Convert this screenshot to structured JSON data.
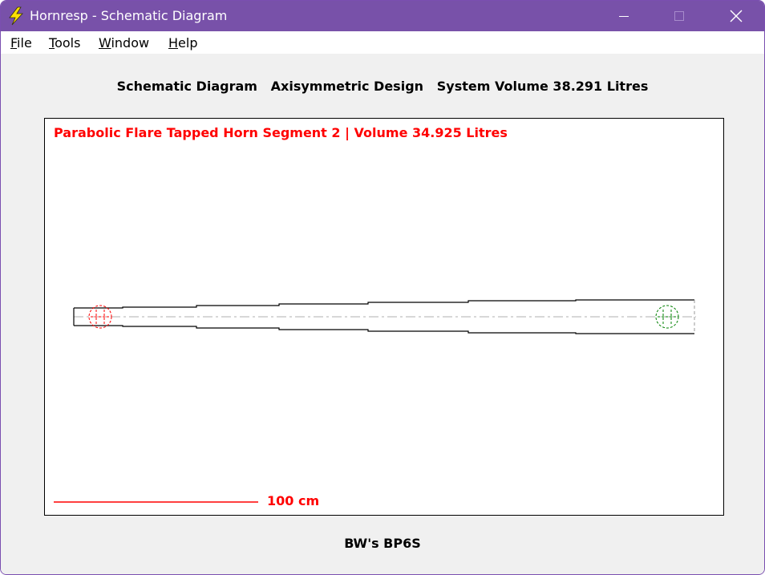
{
  "window": {
    "title": "Hornresp - Schematic Diagram",
    "titlebar_color": "#7851a9"
  },
  "menu": {
    "items": [
      {
        "label": "File",
        "accel": "F",
        "rest": "ile"
      },
      {
        "label": "Tools",
        "accel": "T",
        "rest": "ools"
      },
      {
        "label": "Window",
        "accel": "W",
        "rest": "indow"
      },
      {
        "label": "Help",
        "accel": "H",
        "rest": "elp"
      }
    ]
  },
  "header": {
    "text": "Schematic Diagram   Axisymmetric Design   System Volume 38.291 Litres"
  },
  "diagram": {
    "segment_label": "Parabolic Flare Tapped Horn Segment 2 | Volume 34.925 Litres",
    "scale_label": "100 cm",
    "label_color": "#ff0000",
    "driver_1_color": "#ff0000",
    "driver_2_color": "#008000"
  },
  "footer": {
    "text": "BW's BP6S"
  },
  "icons": {
    "app": "lightning-icon",
    "minimize": "minimize-icon",
    "maximize": "maximize-icon",
    "close": "close-icon"
  }
}
